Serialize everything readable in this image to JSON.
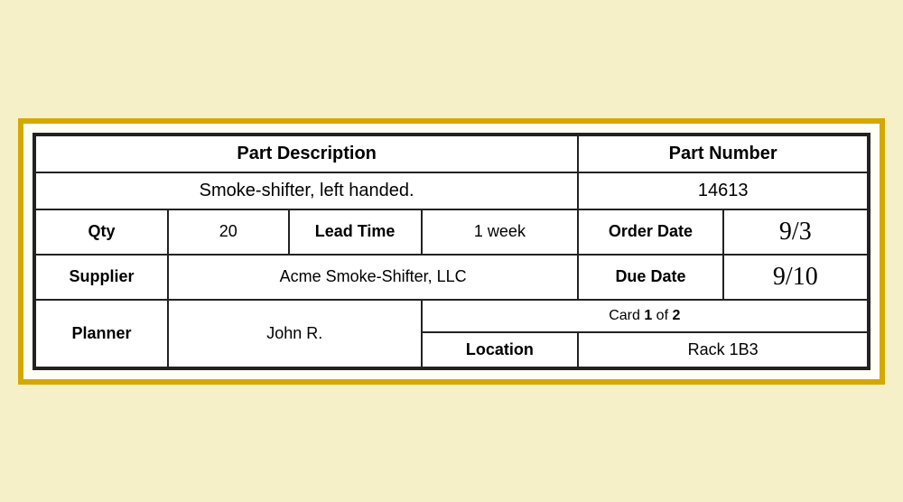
{
  "card": {
    "part_description_header": "Part Description",
    "part_number_header": "Part Number",
    "part_description_value": "Smoke-shifter, left handed.",
    "part_number_value": "14613",
    "qty_label": "Qty",
    "qty_value": "20",
    "lead_time_label": "Lead Time",
    "lead_time_value": "1 week",
    "order_date_label": "Order Date",
    "order_date_value": "9/3",
    "supplier_label": "Supplier",
    "supplier_value": "Acme Smoke-Shifter, LLC",
    "due_date_label": "Due Date",
    "due_date_value": "9/10",
    "planner_label": "Planner",
    "planner_value": "John R.",
    "card_of_prefix": "Card ",
    "card_of_number": "1",
    "card_of_middle": " of ",
    "card_of_total": "2",
    "location_label": "Location",
    "location_value": "Rack 1B3"
  }
}
